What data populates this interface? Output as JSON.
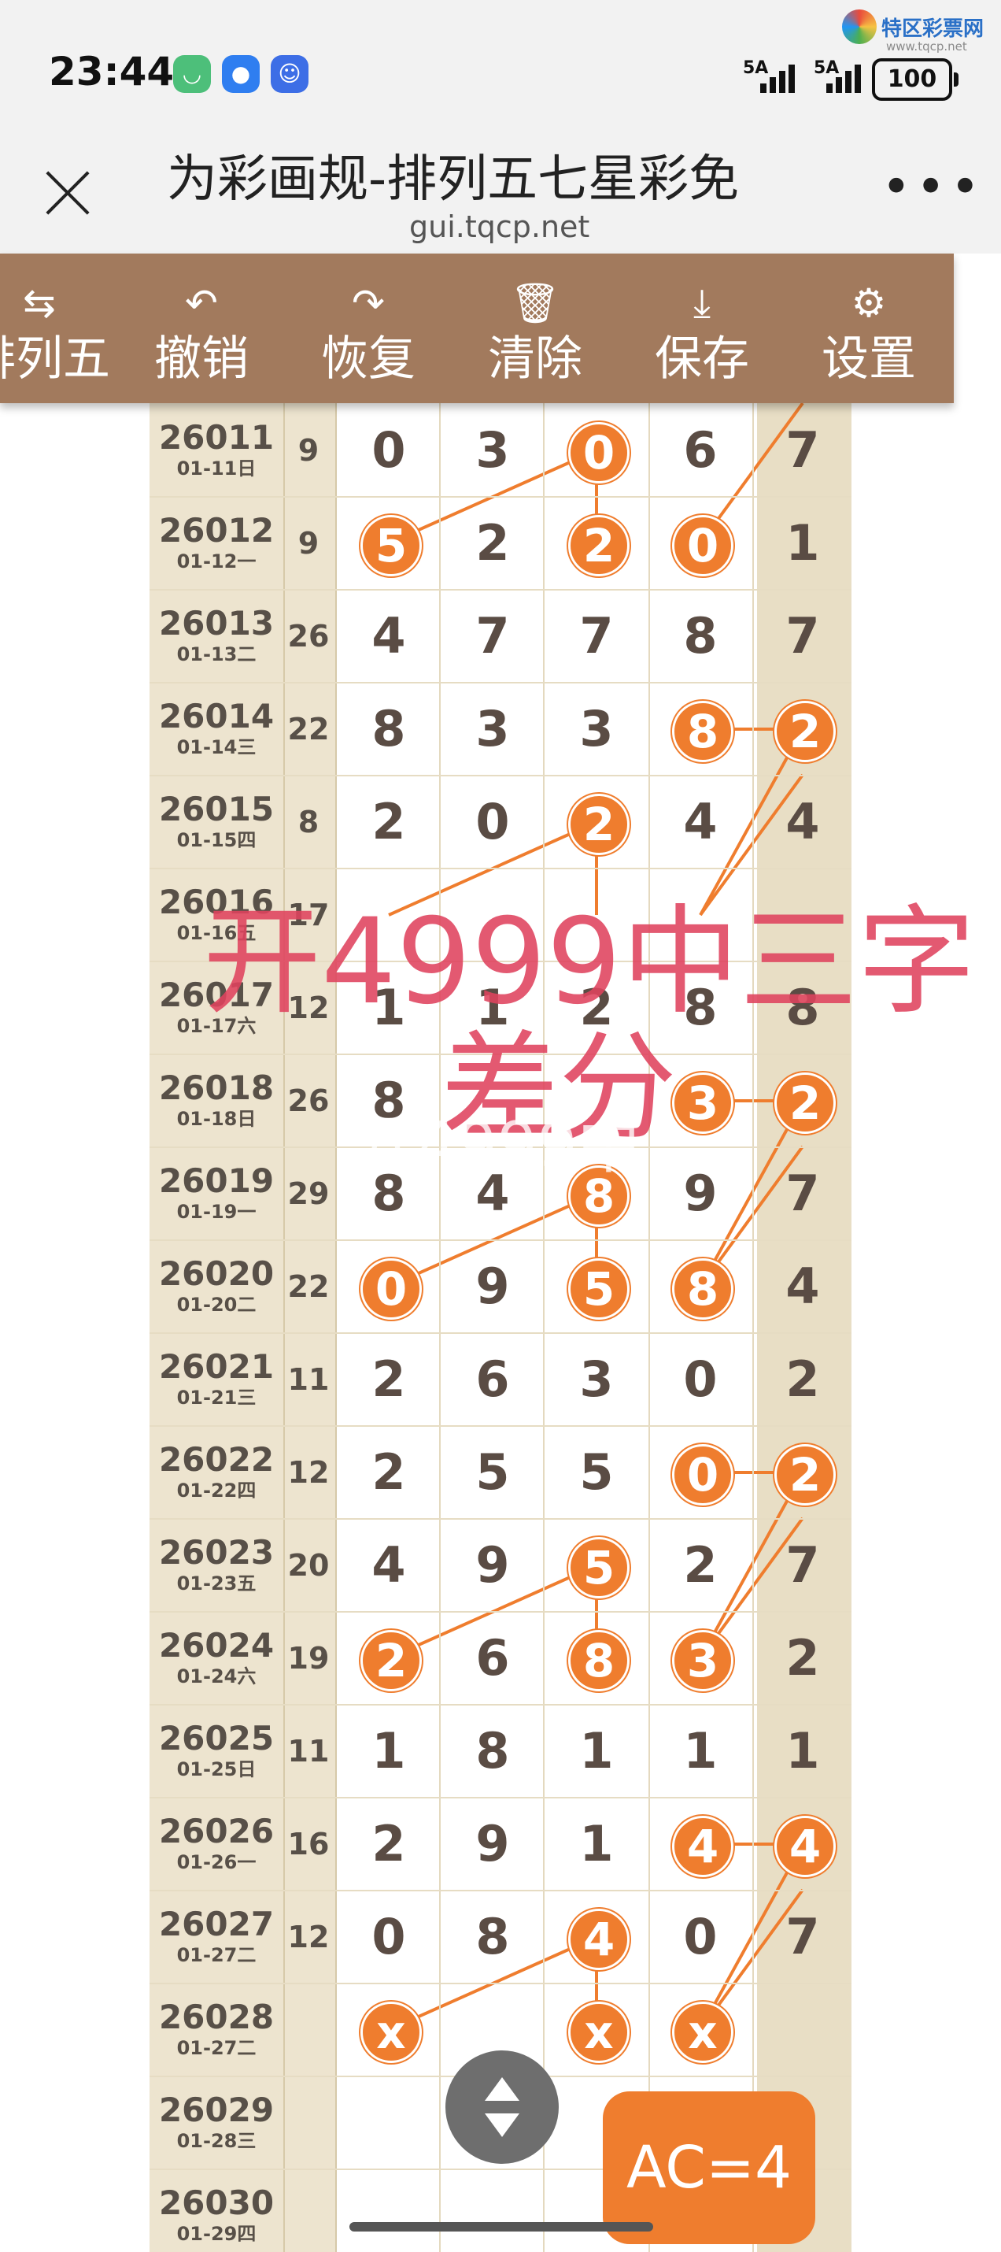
{
  "status_bar": {
    "time": "23:44",
    "signal_1": "5A",
    "signal_2": "5A",
    "battery": "100"
  },
  "brand": {
    "name": "特区彩票网",
    "url": "www.tqcp.net"
  },
  "browser": {
    "title": "为彩画规-排列五七星彩免",
    "domain": "gui.tqcp.net"
  },
  "toolbar": [
    {
      "label": "排列五",
      "icon": "swap-icon",
      "glyph": "⇆"
    },
    {
      "label": "撤销",
      "icon": "undo-icon",
      "glyph": "↶"
    },
    {
      "label": "恢复",
      "icon": "redo-icon",
      "glyph": "↷"
    },
    {
      "label": "清除",
      "icon": "trash-icon",
      "glyph": "🗑"
    },
    {
      "label": "保存",
      "icon": "download-icon",
      "glyph": "⤓"
    },
    {
      "label": "设置",
      "icon": "gear-icon",
      "glyph": "⚙"
    }
  ],
  "rows": [
    {
      "no": "26011",
      "date": "01-11日",
      "sum": "9",
      "d": [
        "0",
        "3",
        "0",
        "6",
        "7"
      ],
      "hl": [
        false,
        false,
        true,
        false,
        false
      ]
    },
    {
      "no": "26012",
      "date": "01-12一",
      "sum": "9",
      "d": [
        "5",
        "2",
        "2",
        "0",
        "1"
      ],
      "hl": [
        true,
        false,
        true,
        true,
        false
      ]
    },
    {
      "no": "26013",
      "date": "01-13二",
      "sum": "26",
      "d": [
        "4",
        "7",
        "7",
        "8",
        "7"
      ],
      "hl": [
        false,
        false,
        false,
        false,
        false
      ]
    },
    {
      "no": "26014",
      "date": "01-14三",
      "sum": "22",
      "d": [
        "8",
        "3",
        "3",
        "8",
        "2"
      ],
      "hl": [
        false,
        false,
        false,
        true,
        true
      ]
    },
    {
      "no": "26015",
      "date": "01-15四",
      "sum": "8",
      "d": [
        "2",
        "0",
        "2",
        "4",
        "4"
      ],
      "hl": [
        false,
        false,
        true,
        false,
        false
      ]
    },
    {
      "no": "26016",
      "date": "01-16五",
      "sum": "17",
      "d": [
        "",
        "",
        "",
        "",
        ""
      ],
      "hl": [
        false,
        false,
        false,
        false,
        false
      ]
    },
    {
      "no": "26017",
      "date": "01-17六",
      "sum": "12",
      "d": [
        "1",
        "1",
        "2",
        "8",
        "8"
      ],
      "hl": [
        false,
        false,
        false,
        false,
        false
      ]
    },
    {
      "no": "26018",
      "date": "01-18日",
      "sum": "26",
      "d": [
        "8",
        "",
        "",
        "3",
        "2"
      ],
      "hl": [
        false,
        false,
        false,
        true,
        true
      ]
    },
    {
      "no": "26019",
      "date": "01-19一",
      "sum": "29",
      "d": [
        "8",
        "4",
        "8",
        "9",
        "7"
      ],
      "hl": [
        false,
        false,
        true,
        false,
        false
      ]
    },
    {
      "no": "26020",
      "date": "01-20二",
      "sum": "22",
      "d": [
        "0",
        "9",
        "5",
        "8",
        "4"
      ],
      "hl": [
        true,
        false,
        true,
        true,
        false
      ]
    },
    {
      "no": "26021",
      "date": "01-21三",
      "sum": "11",
      "d": [
        "2",
        "6",
        "3",
        "0",
        "2"
      ],
      "hl": [
        false,
        false,
        false,
        false,
        false
      ]
    },
    {
      "no": "26022",
      "date": "01-22四",
      "sum": "12",
      "d": [
        "2",
        "5",
        "5",
        "0",
        "2"
      ],
      "hl": [
        false,
        false,
        false,
        true,
        true
      ]
    },
    {
      "no": "26023",
      "date": "01-23五",
      "sum": "20",
      "d": [
        "4",
        "9",
        "5",
        "2",
        "7"
      ],
      "hl": [
        false,
        false,
        true,
        false,
        false
      ]
    },
    {
      "no": "26024",
      "date": "01-24六",
      "sum": "19",
      "d": [
        "2",
        "6",
        "8",
        "3",
        "2"
      ],
      "hl": [
        true,
        false,
        true,
        true,
        false
      ]
    },
    {
      "no": "26025",
      "date": "01-25日",
      "sum": "11",
      "d": [
        "1",
        "8",
        "1",
        "1",
        "1"
      ],
      "hl": [
        false,
        false,
        false,
        false,
        false
      ]
    },
    {
      "no": "26026",
      "date": "01-26一",
      "sum": "16",
      "d": [
        "2",
        "9",
        "1",
        "4",
        "4"
      ],
      "hl": [
        false,
        false,
        false,
        true,
        true
      ]
    },
    {
      "no": "26027",
      "date": "01-27二",
      "sum": "12",
      "d": [
        "0",
        "8",
        "4",
        "0",
        "7"
      ],
      "hl": [
        false,
        false,
        true,
        false,
        false
      ]
    },
    {
      "no": "26028",
      "date": "01-27二",
      "sum": "",
      "d": [
        "x",
        "",
        "x",
        "x",
        ""
      ],
      "hl": [
        true,
        false,
        true,
        true,
        false
      ]
    },
    {
      "no": "26029",
      "date": "01-28三",
      "sum": "",
      "d": [
        "",
        "",
        "",
        "",
        ""
      ],
      "hl": [
        false,
        false,
        false,
        false,
        false
      ]
    },
    {
      "no": "26030",
      "date": "01-29四",
      "sum": "",
      "d": [
        "",
        "",
        "",
        "",
        ""
      ],
      "hl": [
        false,
        false,
        false,
        false,
        false
      ]
    }
  ],
  "watermark": {
    "line1": "开4999中三字",
    "line2": "差分",
    "line3": "开4999中"
  },
  "ac_badge": "AC=4",
  "colors": {
    "toolbar": "#a27a5d",
    "ball": "#ef7d2e",
    "watermark": "#e0435e",
    "grid_bg": "#ede4cf"
  }
}
